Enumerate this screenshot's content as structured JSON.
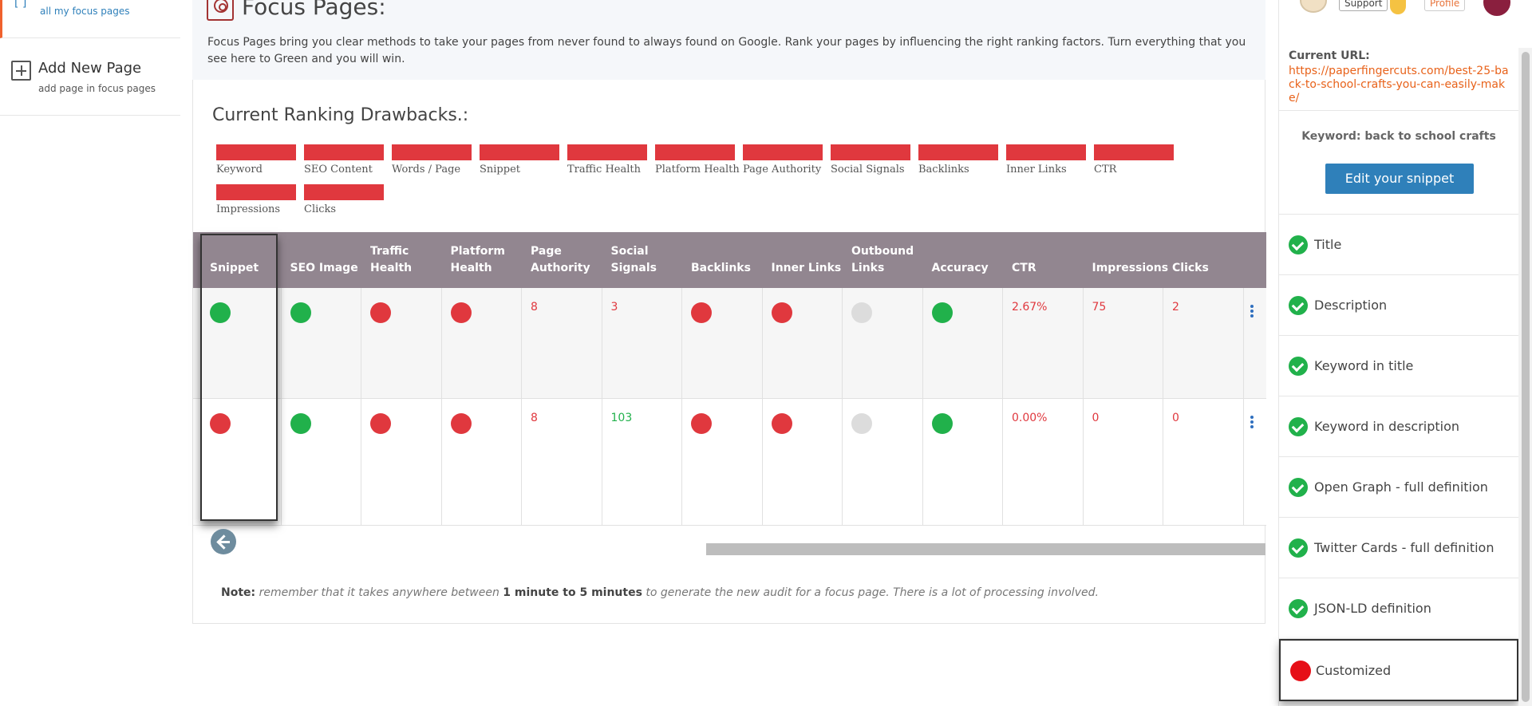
{
  "sidebar": {
    "top_item": {
      "fragment": "[ ]",
      "sub": "all my focus pages"
    },
    "add_item": {
      "title": "Add New Page",
      "sub": "add page in focus pages"
    }
  },
  "header": {
    "title": "Focus Pages:",
    "description": "Focus Pages bring you clear methods to take your pages from never found to always found on Google. Rank your pages by influencing the right ranking factors. Turn everything that you see here to Green and you will win."
  },
  "drawbacks": {
    "title": "Current Ranking Drawbacks.:",
    "items": [
      "Keyword",
      "SEO Content",
      "Words / Page",
      "Snippet",
      "Traffic Health",
      "Platform Health",
      "Page Authority",
      "Social Signals",
      "Backlinks",
      "Inner Links",
      "CTR",
      "Impressions",
      "Clicks"
    ],
    "bar_color": "#e0383e"
  },
  "table": {
    "headers": [
      "Snippet",
      "SEO Image",
      "Traffic Health",
      "Platform Health",
      "Page Authority",
      "Social Signals",
      "Backlinks",
      "Inner Links",
      "Outbound Links",
      "Accuracy",
      "CTR",
      "Impressions",
      "Clicks"
    ],
    "rows": [
      {
        "snippet": "green",
        "seo_image": "green",
        "traffic_health": "red",
        "platform_health": "red",
        "page_authority": "8",
        "social_signals": "3",
        "backlinks": "red",
        "inner_links": "red",
        "outbound_links": "gray",
        "accuracy": "green",
        "ctr": "2.67%",
        "impressions": "75",
        "clicks": "2"
      },
      {
        "snippet": "red",
        "seo_image": "green",
        "traffic_health": "red",
        "platform_health": "red",
        "page_authority": "8",
        "social_signals": "103",
        "backlinks": "red",
        "inner_links": "red",
        "outbound_links": "gray",
        "accuracy": "green",
        "ctr": "0.00%",
        "impressions": "0",
        "clicks": "0"
      }
    ]
  },
  "note": {
    "prefix": "Note:",
    "part1": " remember that it takes anywhere between ",
    "bold": "1 minute to 5 minutes",
    "part2": " to generate the new audit for a focus page. There is a lot of processing involved."
  },
  "right_panel": {
    "support_label": "Support",
    "profile_label": "Profile",
    "current_url_label": "Current URL:",
    "current_url": "https://paperfingercuts.com/best-25-back-to-school-crafts-you-can-easily-make/",
    "keyword_label": "Keyword: back to school crafts",
    "edit_snippet_label": "Edit your snippet",
    "checks": [
      {
        "label": "Title",
        "status": "pass"
      },
      {
        "label": "Description",
        "status": "pass"
      },
      {
        "label": "Keyword in title",
        "status": "pass"
      },
      {
        "label": "Keyword in description",
        "status": "pass"
      },
      {
        "label": "Open Graph - full definition",
        "status": "pass"
      },
      {
        "label": "Twitter Cards - full definition",
        "status": "pass"
      },
      {
        "label": "JSON-LD definition",
        "status": "pass"
      },
      {
        "label": "Customized",
        "status": "fail"
      }
    ]
  },
  "colors": {
    "accent_orange": "#f0612d",
    "link_blue": "#2f80ba",
    "status_green": "#21b14b",
    "status_red": "#e0383e",
    "header_purple": "#928690"
  }
}
